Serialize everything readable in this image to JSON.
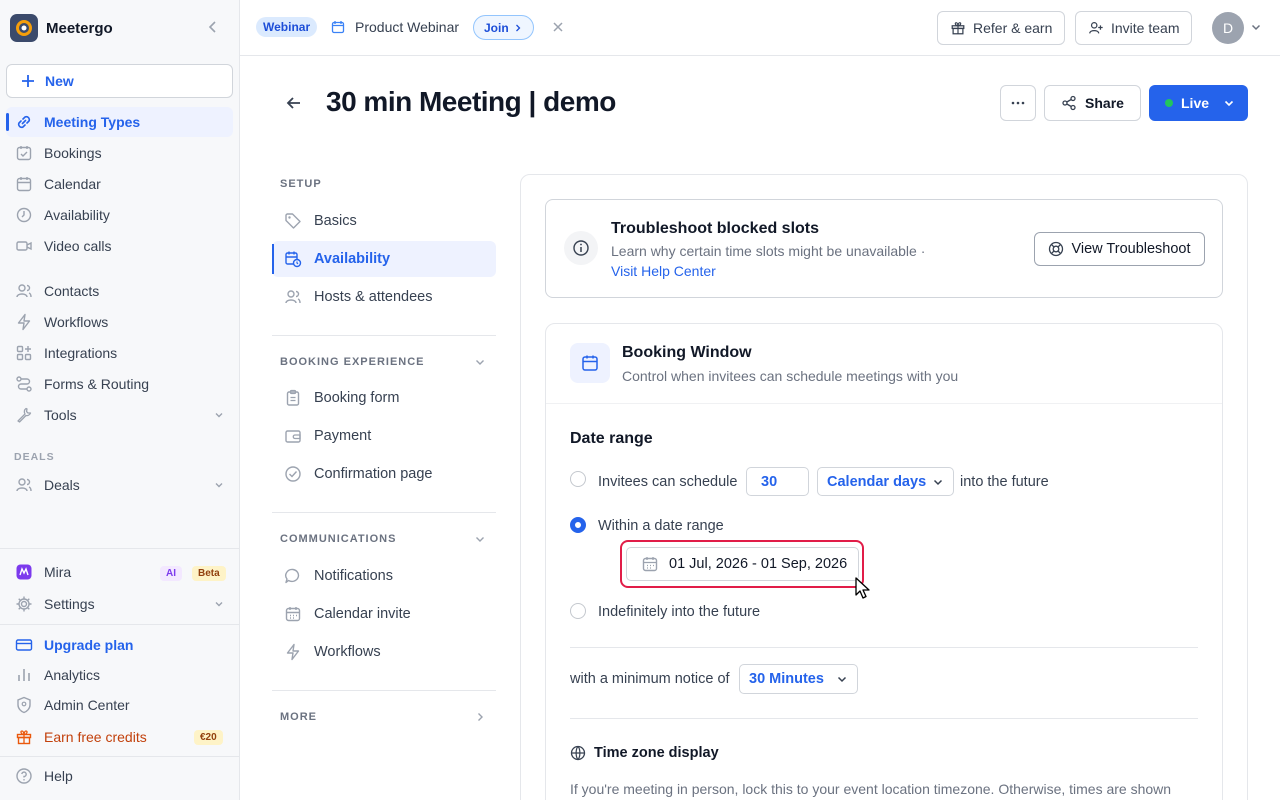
{
  "app": {
    "name": "Meetergo"
  },
  "sidebar": {
    "new_label": "New",
    "items": [
      {
        "label": "Meeting Types",
        "icon": "link-icon"
      },
      {
        "label": "Bookings",
        "icon": "calendar-check-icon"
      },
      {
        "label": "Calendar",
        "icon": "calendar-icon"
      },
      {
        "label": "Availability",
        "icon": "clock-icon"
      },
      {
        "label": "Video calls",
        "icon": "video-icon"
      },
      {
        "label": "Contacts",
        "icon": "users-icon"
      },
      {
        "label": "Workflows",
        "icon": "bolt-icon"
      },
      {
        "label": "Integrations",
        "icon": "grid-plus-icon"
      },
      {
        "label": "Forms & Routing",
        "icon": "routing-icon"
      },
      {
        "label": "Tools",
        "icon": "wrench-icon"
      }
    ],
    "deals_section": "DEALS",
    "deals_label": "Deals",
    "mira_label": "Mira",
    "mira_ai": "AI",
    "mira_beta": "Beta",
    "settings_label": "Settings",
    "upgrade_label": "Upgrade plan",
    "analytics_label": "Analytics",
    "admin_label": "Admin Center",
    "earn_label": "Earn free credits",
    "earn_badge": "€20",
    "help_label": "Help"
  },
  "topbar": {
    "webinar_badge": "Webinar",
    "webinar_title": "Product Webinar",
    "join_label": "Join",
    "refer_label": "Refer & earn",
    "invite_label": "Invite team",
    "avatar_initial": "D"
  },
  "header": {
    "title": "30 min Meeting | demo",
    "share_label": "Share",
    "live_label": "Live"
  },
  "settings_nav": {
    "setup_label": "SETUP",
    "setup_items": [
      "Basics",
      "Availability",
      "Hosts & attendees"
    ],
    "booking_label": "BOOKING EXPERIENCE",
    "booking_items": [
      "Booking form",
      "Payment",
      "Confirmation page"
    ],
    "comm_label": "COMMUNICATIONS",
    "comm_items": [
      "Notifications",
      "Calendar invite",
      "Workflows"
    ],
    "more_label": "MORE"
  },
  "troubleshoot": {
    "title": "Troubleshoot blocked slots",
    "desc": "Learn why certain time slots might be unavailable ·",
    "link": "Visit Help Center",
    "button": "View Troubleshoot"
  },
  "booking_window": {
    "title": "Booking Window",
    "desc": "Control when invitees can schedule meetings with you",
    "date_range_title": "Date range",
    "opt1_prefix": "Invitees can schedule",
    "opt1_days": "30",
    "opt1_unit": "Calendar days",
    "opt1_suffix": "into the future",
    "opt2_label": "Within a date range",
    "date_range_value": "01 Jul, 2026 - 01 Sep, 2026",
    "opt3_label": "Indefinitely into the future",
    "selected_option": 2,
    "min_notice_label": "with a minimum notice of",
    "min_notice_value": "30 Minutes",
    "tz_title": "Time zone display",
    "tz_desc": "If you're meeting in person, lock this to your event location timezone. Otherwise, times are shown"
  }
}
